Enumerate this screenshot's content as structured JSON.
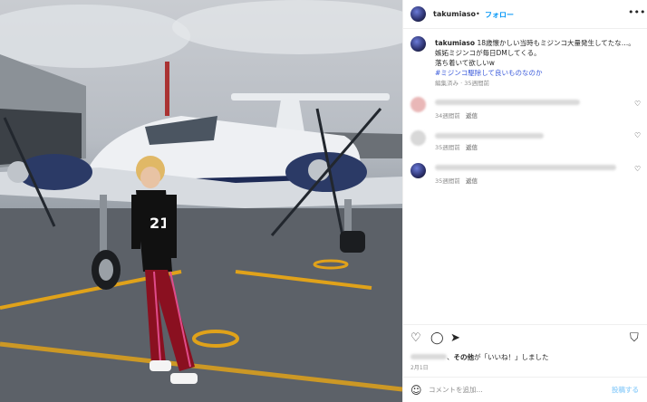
{
  "post": {
    "username": "takumiaso",
    "dot": "•",
    "follow_label": "フォロー",
    "more_icon": "more-horizontal-icon"
  },
  "caption": {
    "username": "takumiaso",
    "line1": "18歳懐かしい当時もミジンコ大量発生してたな…。",
    "line2": "嫉妬ミジンコが毎日DMしてくる。",
    "line3": "落ち着いて欲しいw",
    "hashtag": "#ミジンコ駆除して良いものなのか",
    "meta": "編集済み · 35週間前"
  },
  "comments": [
    {
      "meta_time": "34週間前",
      "reply": "返信"
    },
    {
      "meta_time": "35週間前",
      "reply": "返信"
    },
    {
      "meta_time": "35週間前",
      "reply": "返信"
    }
  ],
  "likes": {
    "text_bold": "その他",
    "text_rest": "が「いいね！」しました",
    "date": "2月1日"
  },
  "comment_box": {
    "placeholder": "コメントを追加...",
    "post_label": "投稿する"
  },
  "colors": {
    "accent": "#0095f6",
    "hashtag": "#3b5bdb",
    "muted": "#8e8e8e"
  }
}
